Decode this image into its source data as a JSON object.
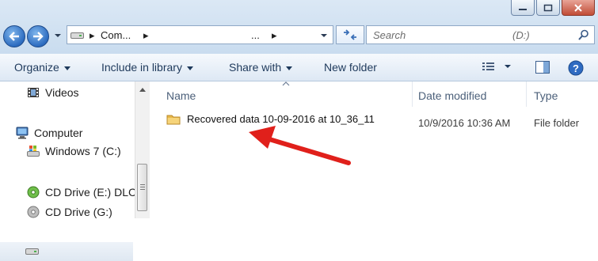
{
  "window": {
    "controls": [
      "minimize",
      "maximize",
      "close"
    ]
  },
  "address": {
    "crumb_1": "Com...",
    "crumb_2": "..."
  },
  "search": {
    "placeholder": "Search",
    "drive_hint": "(D:)"
  },
  "toolbar": {
    "organize": "Organize",
    "include_in_library": "Include in library",
    "share_with": "Share with",
    "new_folder": "New folder"
  },
  "nav": {
    "videos": "Videos",
    "computer": "Computer",
    "windows7": "Windows 7 (C:)",
    "cd_drive_e": "CD Drive (E:) DLC",
    "cd_drive_partial": "CD Drive (G:)"
  },
  "columns": {
    "name": "Name",
    "date_modified": "Date modified",
    "type": "Type"
  },
  "files": [
    {
      "name": "Recovered data 10-09-2016 at 10_36_11",
      "date_modified": "10/9/2016 10:36 AM",
      "type": "File folder"
    }
  ],
  "annotation": {
    "arrow_color": "#e0201b"
  },
  "colors": {
    "accent": "#1e395b",
    "chrome": "#cfdff0"
  }
}
